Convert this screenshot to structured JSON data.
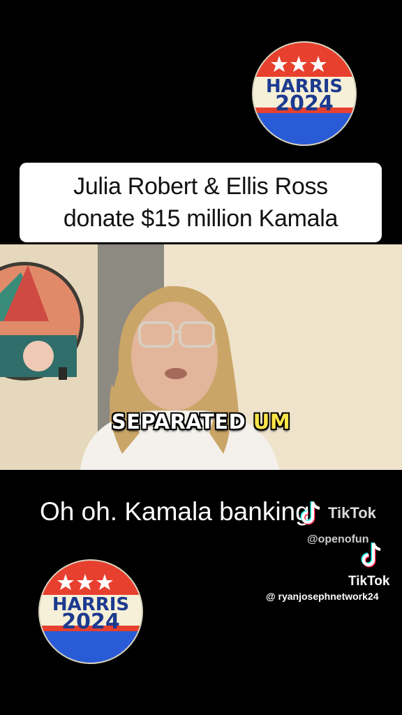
{
  "badge": {
    "line1": "HARRIS",
    "line2": "2024"
  },
  "headline": {
    "line1": "Julia Robert & Ellis Ross",
    "line2": "donate $15 million Kamala"
  },
  "video": {
    "caption_word": "SEPARATED",
    "caption_highlight": "UM"
  },
  "lower_text": "Oh oh.  Kamala banking",
  "watermark_1": {
    "brand": "TikTok",
    "handle": "@openofun"
  },
  "watermark_2": {
    "brand": "TikTok",
    "handle": "@ ryanjosephnetwork24"
  },
  "colors": {
    "badge_red": "#e8402f",
    "badge_blue": "#2a5bd6",
    "badge_cream": "#f6f0d8",
    "caption_highlight": "#ffe54a",
    "background": "#000000"
  },
  "icons": [
    "tiktok-logo-icon",
    "star-icon"
  ]
}
